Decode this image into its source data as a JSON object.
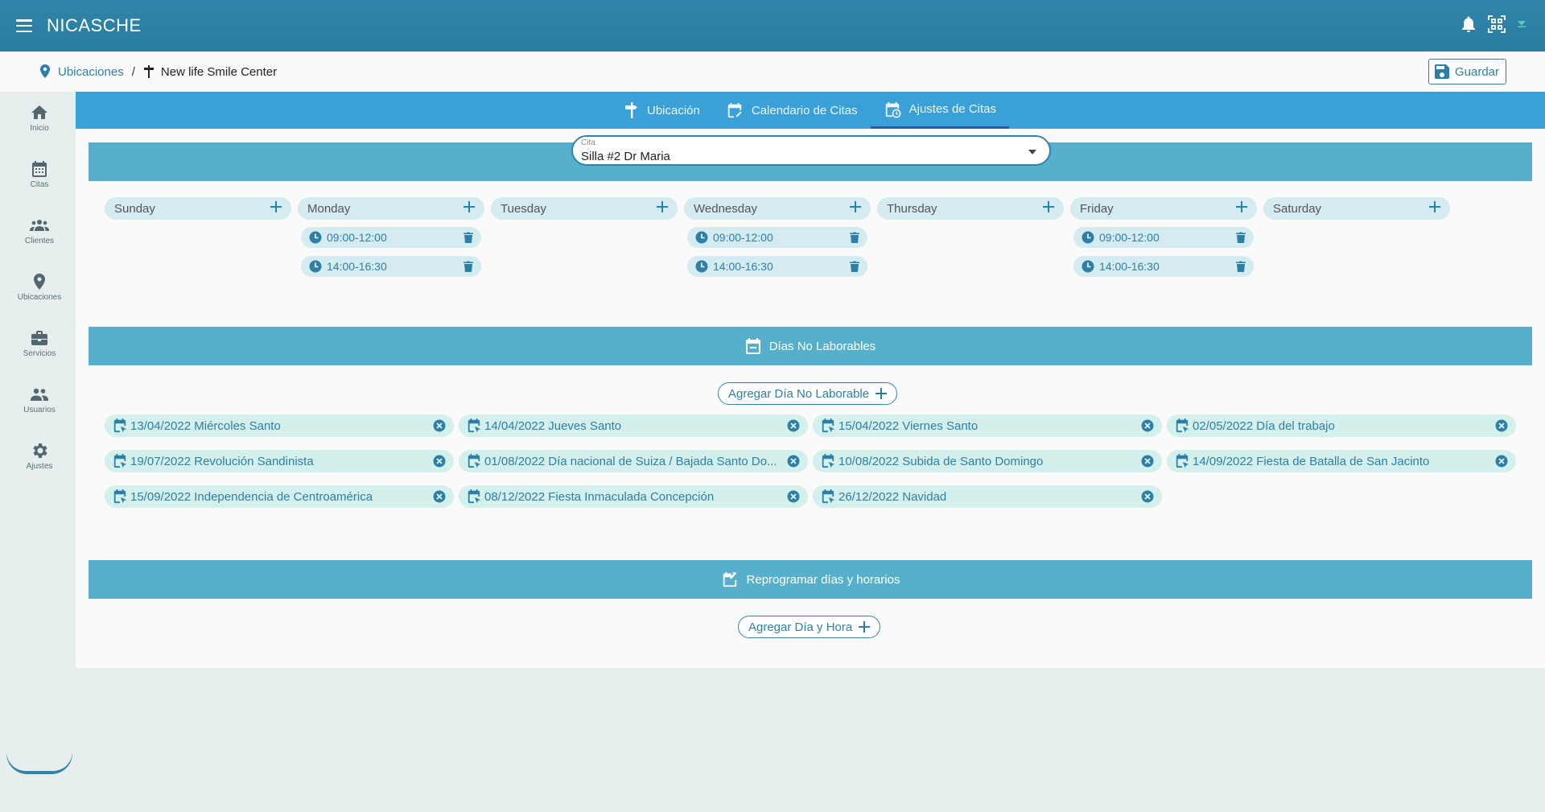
{
  "app": {
    "title": "NICASCHE"
  },
  "breadcrumb": {
    "link": "Ubicaciones",
    "separator": "/",
    "current": "New life Smile Center"
  },
  "toolbar": {
    "save_label": "Guardar"
  },
  "sidebar": {
    "items": [
      {
        "label": "Inicio",
        "icon": "home-icon"
      },
      {
        "label": "Citas",
        "icon": "calendar-icon"
      },
      {
        "label": "Clientes",
        "icon": "group-icon"
      },
      {
        "label": "Ubicaciones",
        "icon": "location-icon"
      },
      {
        "label": "Servicios",
        "icon": "briefcase-icon"
      },
      {
        "label": "Usuarios",
        "icon": "users-icon"
      },
      {
        "label": "Ajustes",
        "icon": "gear-icon"
      }
    ]
  },
  "tabs": [
    {
      "label": "Ubicación",
      "icon": "signpost-icon",
      "active": false
    },
    {
      "label": "Calendario de Citas",
      "icon": "calendar-edit-icon",
      "active": false
    },
    {
      "label": "Ajustes de Citas",
      "icon": "calendar-clock-icon",
      "active": true
    }
  ],
  "cita_select": {
    "label": "Cita",
    "value": "Silla #2 Dr Maria"
  },
  "schedule": {
    "days": [
      {
        "name": "Sunday",
        "slots": []
      },
      {
        "name": "Monday",
        "slots": [
          "09:00-12:00",
          "14:00-16:30"
        ]
      },
      {
        "name": "Tuesday",
        "slots": []
      },
      {
        "name": "Wednesday",
        "slots": [
          "09:00-12:00",
          "14:00-16:30"
        ]
      },
      {
        "name": "Thursday",
        "slots": []
      },
      {
        "name": "Friday",
        "slots": [
          "09:00-12:00",
          "14:00-16:30"
        ]
      },
      {
        "name": "Saturday",
        "slots": []
      }
    ]
  },
  "non_working": {
    "title": "Días No Laborables",
    "add_label": "Agregar Día No Laborable",
    "items": [
      "13/04/2022 Miércoles Santo",
      "14/04/2022 Jueves Santo",
      "15/04/2022 Viernes Santo",
      "02/05/2022 Día del trabajo",
      "19/07/2022 Revolución Sandinista",
      "01/08/2022 Día nacional de Suiza / Bajada Santo Do...",
      "10/08/2022 Subida de Santo Domingo",
      "14/09/2022 Fiesta de Batalla de San Jacinto",
      "15/09/2022 Independencia de Centroamérica",
      "08/12/2022 Fiesta Inmaculada Concepción",
      "26/12/2022 Navidad"
    ]
  },
  "reschedule": {
    "title": "Reprogramar días y horarios",
    "add_label": "Agregar Día y Hora"
  },
  "colors": {
    "topbar": "#2f85a9",
    "tabbar": "#3aa0d8",
    "section": "#56afcb",
    "accent": "#2d7fa6",
    "chip": "#d4ebf2",
    "holiday_chip": "#d4f0ec"
  }
}
